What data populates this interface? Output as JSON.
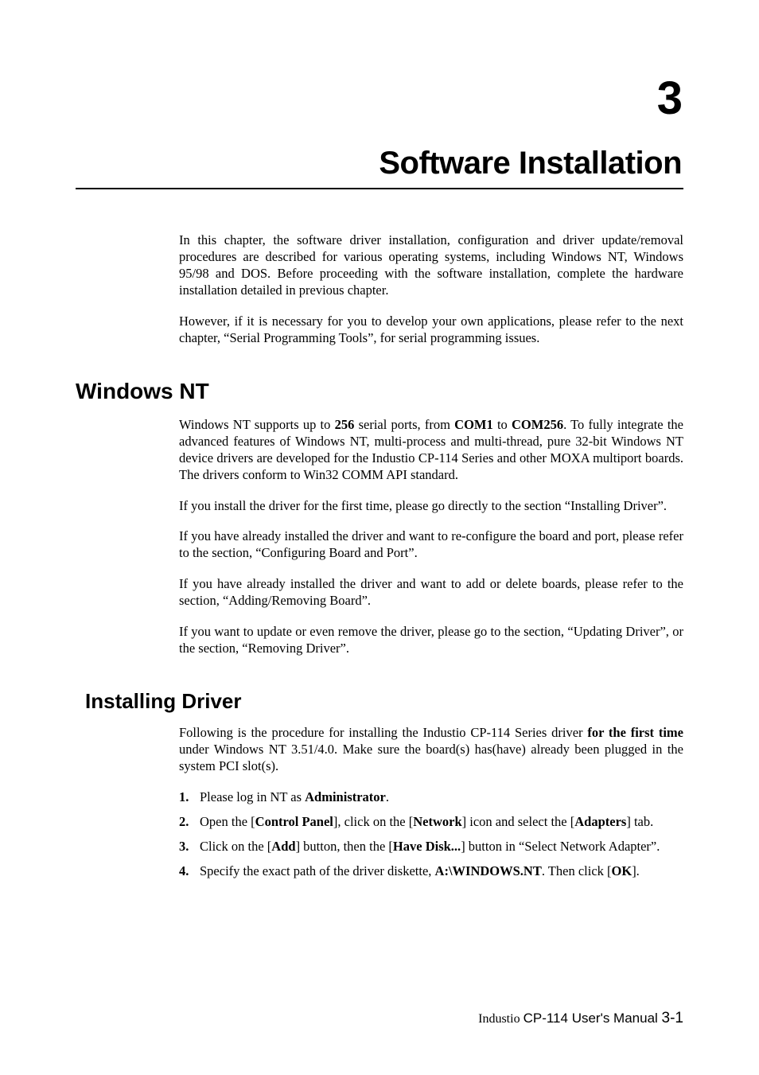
{
  "chapter": {
    "number": "3",
    "title": "Software Installation"
  },
  "intro": {
    "p1": "In this chapter, the software driver installation, configuration and driver update/removal procedures are described for various operating systems, including Windows NT, Windows 95/98 and DOS. Before proceeding with the software installation, complete the hardware installation detailed in previous chapter.",
    "p2": "However, if it is necessary for you to develop your own applications, please refer to the next chapter, “Serial Programming Tools”, for serial programming issues."
  },
  "sections": {
    "windows_nt": {
      "heading": "Windows NT",
      "p1": {
        "t1": "Windows NT supports up to ",
        "b1": "256",
        "t2": " serial ports, from ",
        "b2": "COM1",
        "t3": " to ",
        "b3": "COM256",
        "t4": ". To fully integrate the advanced features of Windows NT, multi-process and multi-thread, pure 32-bit Windows NT device drivers are developed for the Industio CP-114 Series and other MOXA multiport boards. The drivers conform to Win32 COMM API standard."
      },
      "p2": "If you install the driver for the first time, please go directly to the section “Installing Driver”.",
      "p3": "If you have already installed the driver and want to re-configure the board and port, please refer to the section, “Configuring Board and Port”.",
      "p4": "If you have already installed the driver and want to add or delete boards, please refer to the section, “Adding/Removing Board”.",
      "p5": "If you want to update or even remove the driver, please go to the section, “Updating Driver”, or the section, “Removing Driver”."
    },
    "installing_driver": {
      "heading": "Installing Driver",
      "p1": {
        "t1": "Following is the procedure for installing the Industio CP-114 Series driver ",
        "b1": "for the first time",
        "t2": " under Windows NT 3.51/4.0. Make sure the board(s) has(have) already been plugged in the system PCI slot(s)."
      },
      "steps": [
        {
          "num": "1.",
          "parts": {
            "t1": "Please log in NT as ",
            "b1": "Administrator",
            "t2": "."
          }
        },
        {
          "num": "2.",
          "parts": {
            "t1": "Open the [",
            "b1": "Control Panel",
            "t2": "], click on the [",
            "b2": "Network",
            "t3": "] icon and select the [",
            "b3": "Adapters",
            "t4": "] tab."
          }
        },
        {
          "num": "3.",
          "parts": {
            "t1": "Click on the [",
            "b1": "Add",
            "t2": "] button, then the [",
            "b2": "Have Disk...",
            "t3": "] button in “Select Network Adapter”."
          }
        },
        {
          "num": "4.",
          "parts": {
            "t1": "Specify the exact path of the driver diskette, ",
            "b1": "A:\\WINDOWS.NT",
            "t2": ". Then click [",
            "b2": "OK",
            "t3": "]."
          }
        }
      ]
    }
  },
  "footer": {
    "product_prefix": "Industio ",
    "product": "CP-114 ",
    "label": "User's Manual  ",
    "page": "3-1"
  }
}
